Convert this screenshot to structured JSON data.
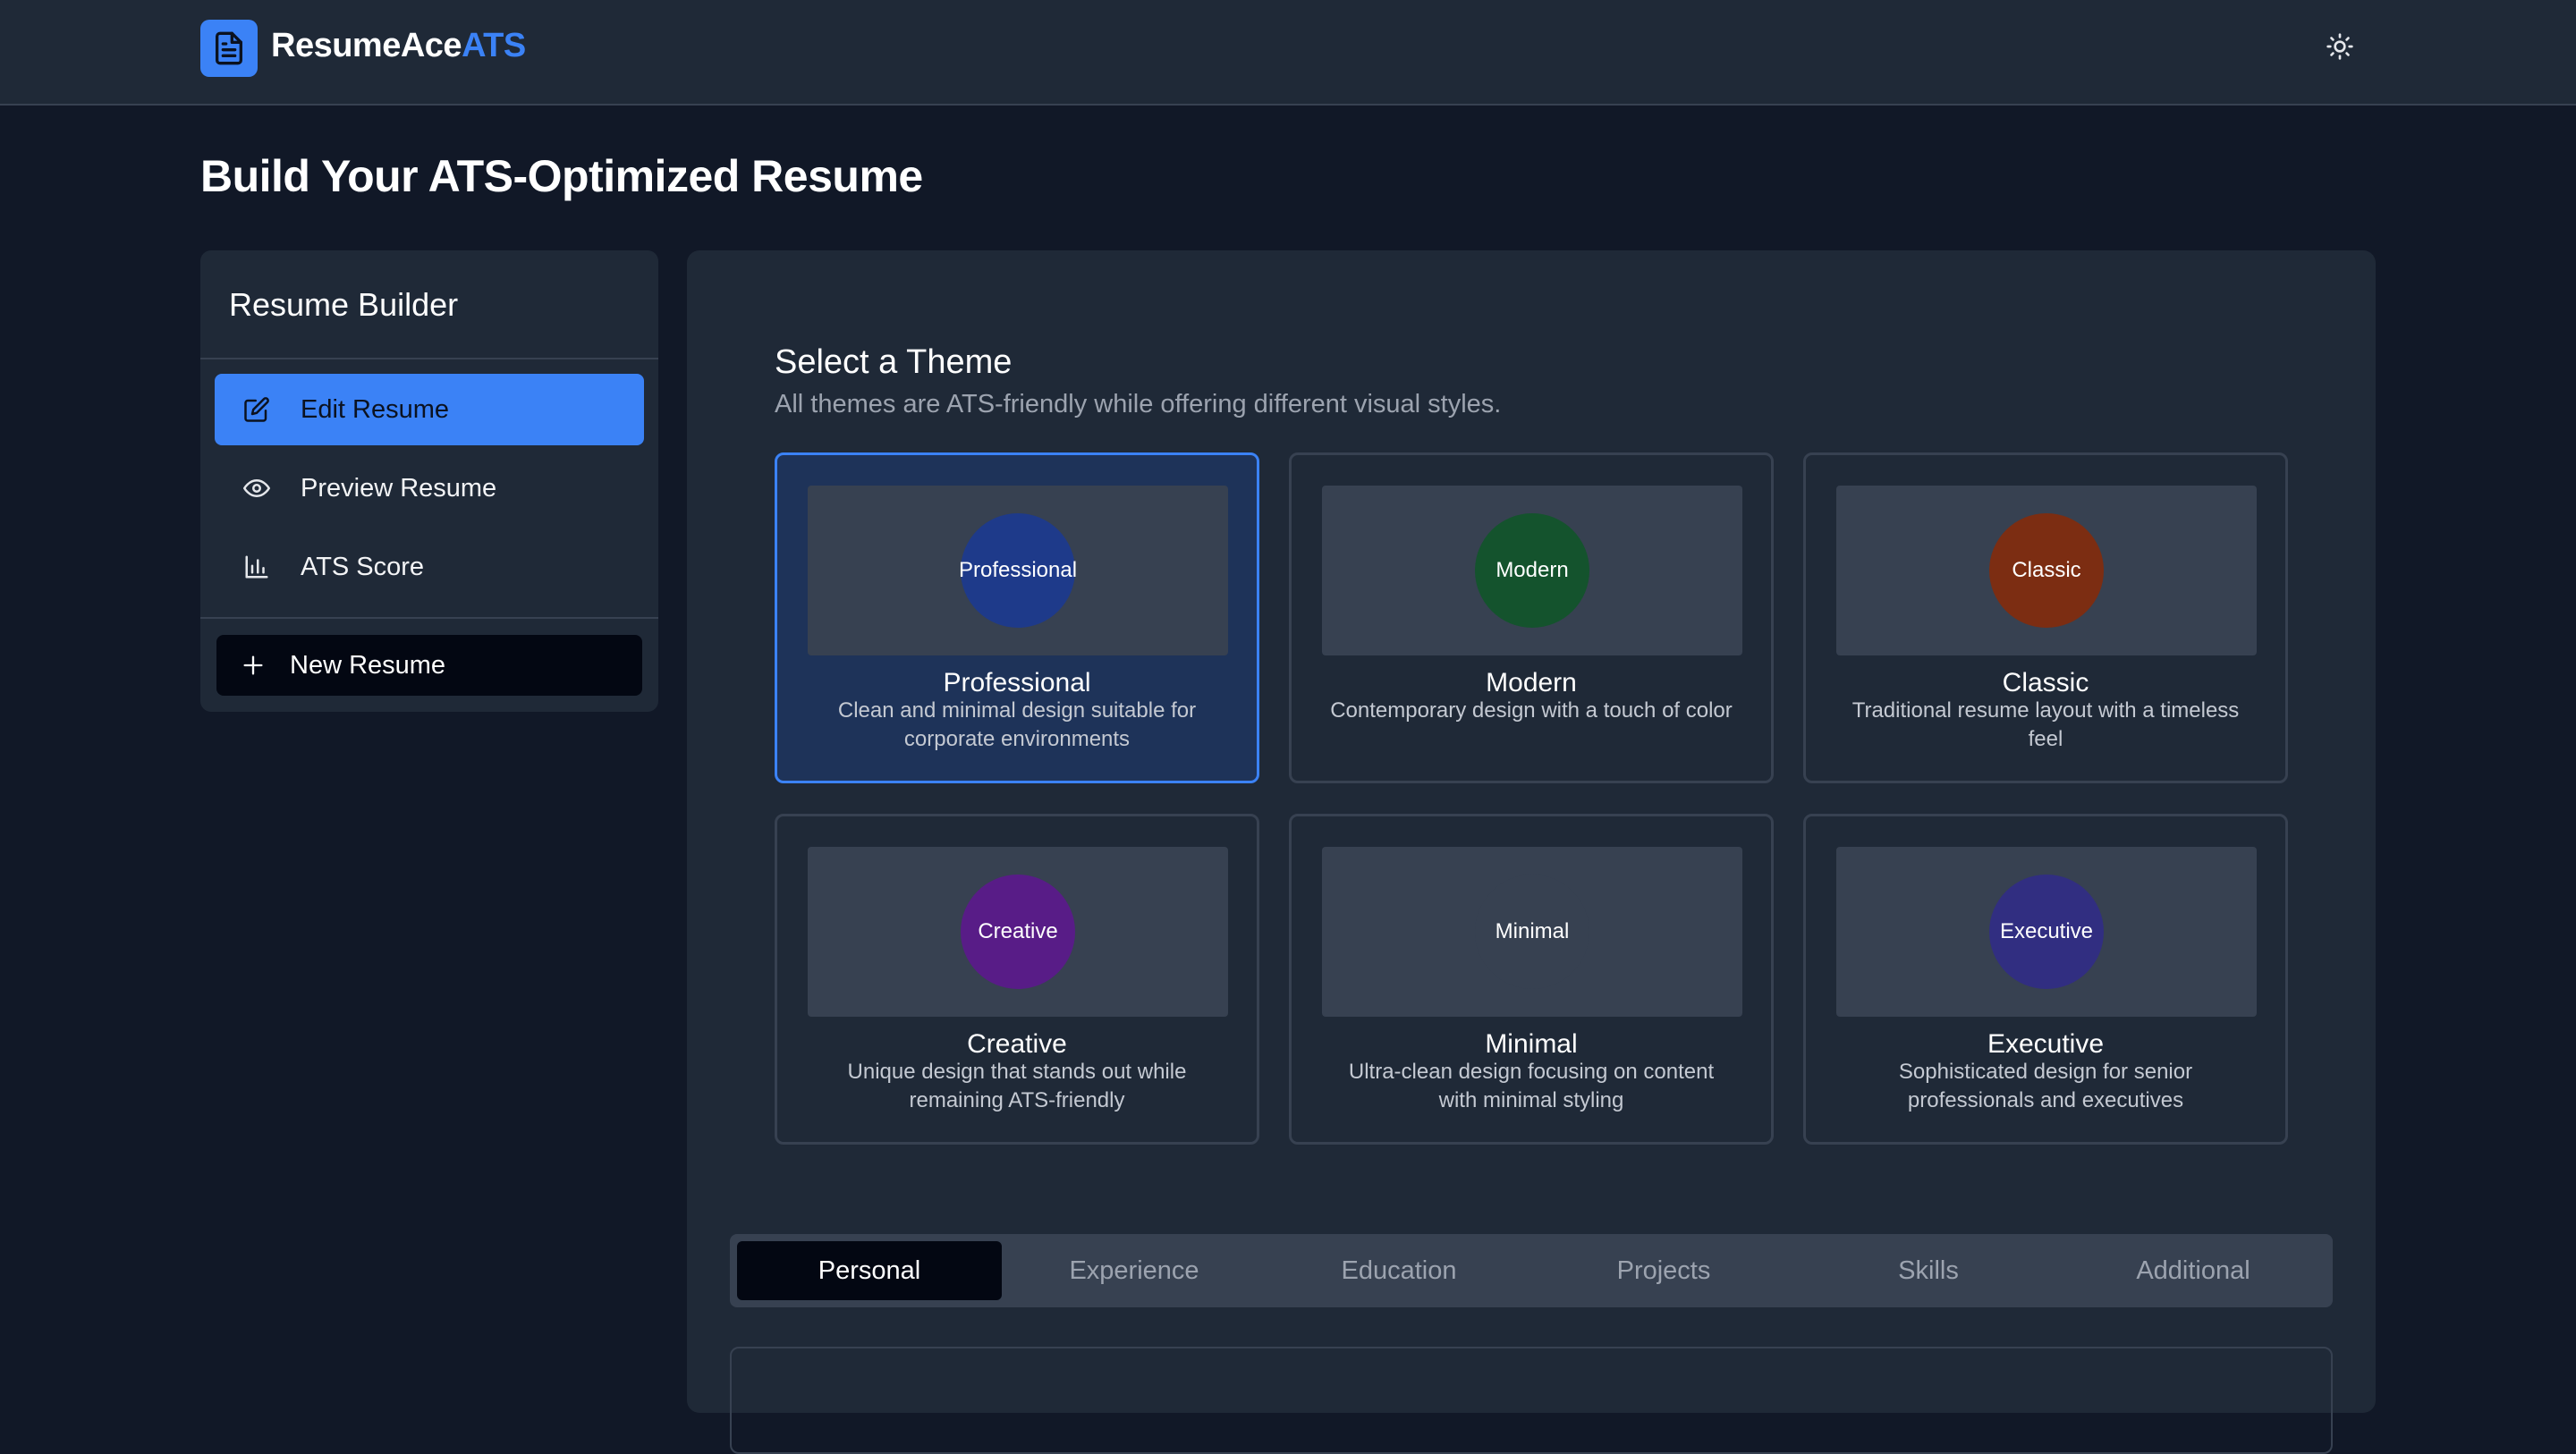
{
  "header": {
    "brand_main": "ResumeAce",
    "brand_accent": "ATS",
    "logo_icon": "document-icon",
    "theme_toggle_icon": "sun-icon"
  },
  "page": {
    "title": "Build Your ATS-Optimized Resume"
  },
  "sidebar": {
    "title": "Resume Builder",
    "items": [
      {
        "label": "Edit Resume",
        "icon": "edit-icon",
        "active": true
      },
      {
        "label": "Preview Resume",
        "icon": "eye-icon",
        "active": false
      },
      {
        "label": "ATS Score",
        "icon": "bar-chart-icon",
        "active": false
      }
    ],
    "new_button": {
      "label": "New Resume",
      "icon": "plus-icon"
    }
  },
  "themes": {
    "title": "Select a Theme",
    "subtitle": "All themes are ATS-friendly while offering different visual styles.",
    "cards": [
      {
        "name": "Professional",
        "badge": "Professional",
        "description": "Clean and minimal design suitable for corporate environments",
        "color": "#1e3a8a",
        "selected": true
      },
      {
        "name": "Modern",
        "badge": "Modern",
        "description": "Contemporary design with a touch of color",
        "color": "#14532d",
        "selected": false
      },
      {
        "name": "Classic",
        "badge": "Classic",
        "description": "Traditional resume layout with a timeless feel",
        "color": "#7c2d12",
        "selected": false
      },
      {
        "name": "Creative",
        "badge": "Creative",
        "description": "Unique design that stands out while remaining ATS-friendly",
        "color": "#581c87",
        "selected": false
      },
      {
        "name": "Minimal",
        "badge": "Minimal",
        "description": "Ultra-clean design focusing on content with minimal styling",
        "color": "#374151",
        "selected": false
      },
      {
        "name": "Executive",
        "badge": "Executive",
        "description": "Sophisticated design for senior professionals and executives",
        "color": "#312e81",
        "selected": false
      }
    ]
  },
  "tabs": [
    {
      "label": "Personal",
      "active": true
    },
    {
      "label": "Experience",
      "active": false
    },
    {
      "label": "Education",
      "active": false
    },
    {
      "label": "Projects",
      "active": false
    },
    {
      "label": "Skills",
      "active": false
    },
    {
      "label": "Additional",
      "active": false
    }
  ]
}
